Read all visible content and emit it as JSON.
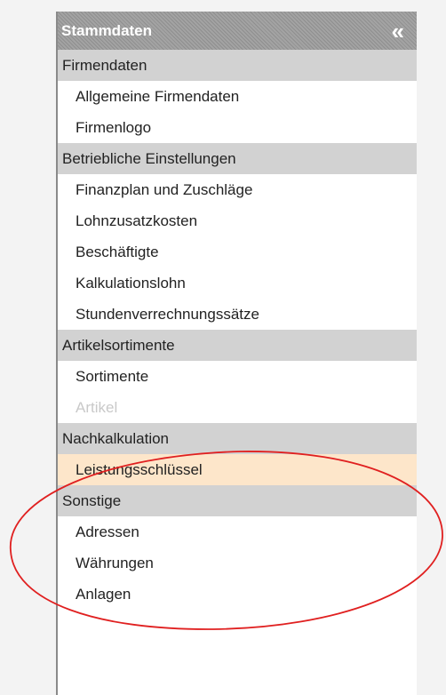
{
  "sidebar": {
    "title": "Stammdaten",
    "collapse_icon": "«",
    "groups": [
      {
        "title": "Firmendaten",
        "items": [
          {
            "label": "Allgemeine Firmendaten"
          },
          {
            "label": "Firmenlogo"
          }
        ]
      },
      {
        "title": "Betriebliche Einstellungen",
        "items": [
          {
            "label": "Finanzplan und Zuschläge"
          },
          {
            "label": "Lohnzusatzkosten"
          },
          {
            "label": "Beschäftigte"
          },
          {
            "label": "Kalkulationslohn"
          },
          {
            "label": "Stundenverrechnungssätze"
          }
        ]
      },
      {
        "title": "Artikelsortimente",
        "items": [
          {
            "label": "Sortimente"
          },
          {
            "label": "Artikel",
            "state": "disabled"
          }
        ]
      },
      {
        "title": "Nachkalkulation",
        "items": [
          {
            "label": "Leistungsschlüssel",
            "state": "active"
          }
        ]
      },
      {
        "title": "Sonstige",
        "items": [
          {
            "label": "Adressen"
          },
          {
            "label": "Währungen"
          },
          {
            "label": "Anlagen"
          }
        ]
      }
    ]
  },
  "colors": {
    "header_bg": "#999999",
    "group_bg": "#d2d2d2",
    "active_bg": "#fde6ca",
    "annotation": "#e02020"
  }
}
